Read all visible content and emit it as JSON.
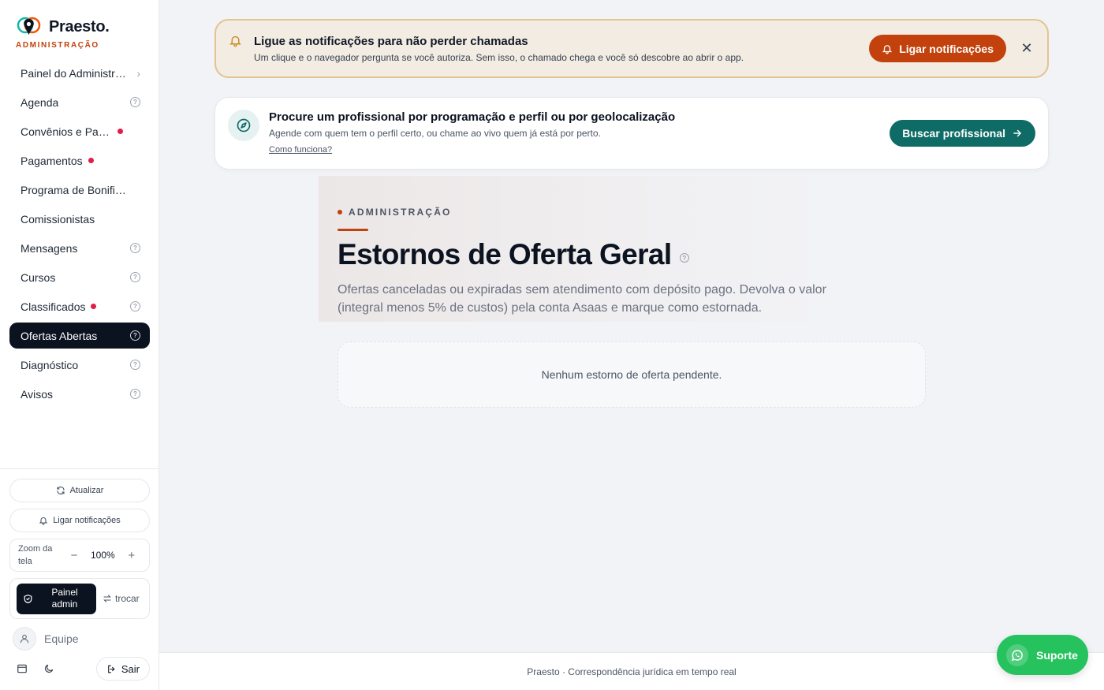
{
  "brand": {
    "name": "Praesto.",
    "subtitle": "ADMINISTRAÇÃO"
  },
  "sidebar": {
    "items": [
      {
        "label": "Painel do Administrador",
        "icon": "chevron-right-icon"
      },
      {
        "label": "Agenda",
        "icon": "help-icon"
      },
      {
        "label": "Convênios e Parcerias",
        "badge": true
      },
      {
        "label": "Pagamentos",
        "badge": true
      },
      {
        "label": "Programa de Bonificação"
      },
      {
        "label": "Comissionistas"
      },
      {
        "label": "Mensagens",
        "icon": "help-icon"
      },
      {
        "label": "Cursos",
        "icon": "help-icon"
      },
      {
        "label": "Classificados",
        "badge": true,
        "icon": "help-icon"
      },
      {
        "label": "Ofertas Abertas",
        "icon": "help-icon",
        "active": true
      },
      {
        "label": "Diagnóstico",
        "icon": "help-icon"
      },
      {
        "label": "Avisos",
        "icon": "help-icon"
      }
    ],
    "refresh_label": "Atualizar",
    "notif_label": "Ligar notificações",
    "zoom_label": "Zoom da tela",
    "zoom_value": "100%",
    "zoom_minus": "−",
    "zoom_plus": "+",
    "admin_label": "Painel admin",
    "switch_label": "trocar",
    "team_label": "Equipe",
    "logout_label": "Sair"
  },
  "notif_banner": {
    "title": "Ligue as notificações para não perder chamadas",
    "desc": "Um clique e o navegador pergunta se você autoriza. Sem isso, o chamado chega e você só descobre ao abrir o app.",
    "button": "Ligar notificações",
    "close": "✕"
  },
  "search_card": {
    "title": "Procure um profissional por programação e perfil ou por geolocalização",
    "desc": "Agende com quem tem o perfil certo, ou chame ao vivo quem já está por perto.",
    "link": "Como funciona?",
    "button": "Buscar profissional"
  },
  "page": {
    "tag": "ADMINISTRAÇÃO",
    "title": "Estornos de Oferta Geral",
    "desc": "Ofertas canceladas ou expiradas sem atendimento com depósito pago. Devolva o valor (integral menos 5% de custos) pela conta Asaas e marque como estornada.",
    "empty": "Nenhum estorno de oferta pendente."
  },
  "footer": {
    "text": "Praesto · Correspondência jurídica em tempo real"
  },
  "support": {
    "label": "Suporte"
  },
  "colors": {
    "accent": "#c2410c",
    "teal": "#0f6b66",
    "active_nav": "#0b1220",
    "whatsapp": "#25c25e",
    "badge": "#e11d48"
  }
}
